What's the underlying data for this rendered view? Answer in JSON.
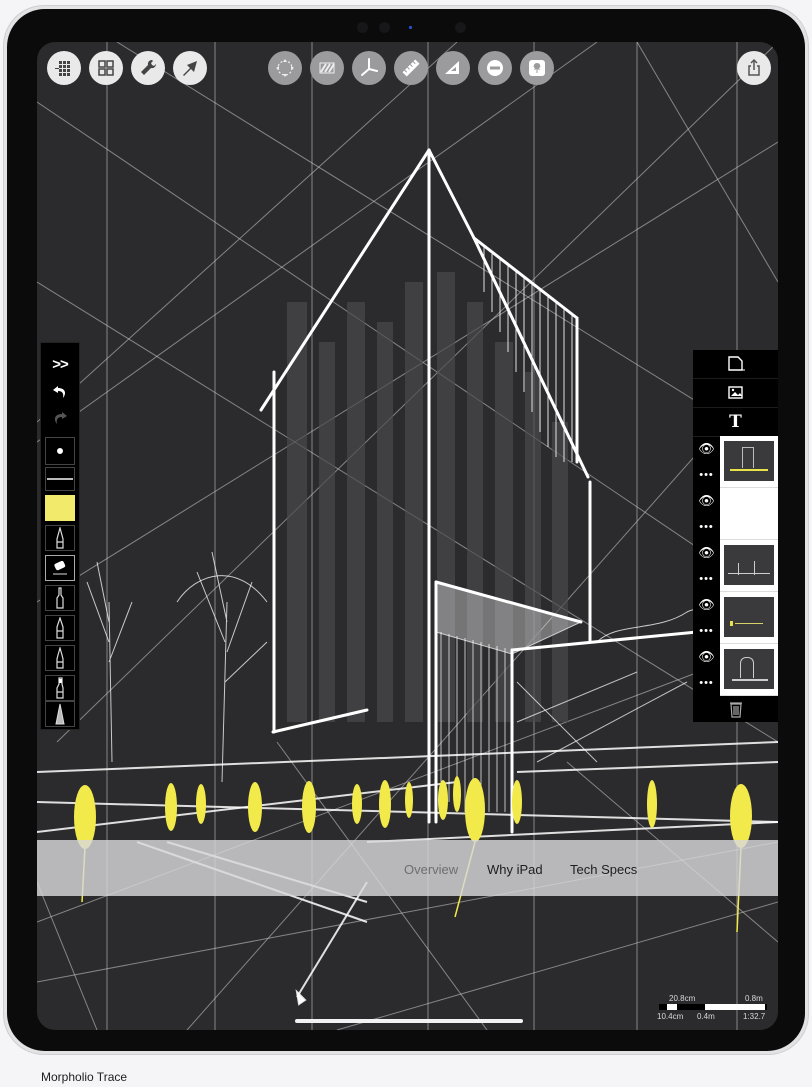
{
  "app": {
    "name": "Morpholio Trace",
    "caption": "Morpholio Trace"
  },
  "top_toolbar": {
    "left_buttons": [
      {
        "icon": "grid-dots-icon",
        "label": "Grid"
      },
      {
        "icon": "gallery-icon",
        "label": "Gallery"
      },
      {
        "icon": "wrench-icon",
        "label": "Settings"
      },
      {
        "icon": "arrow-icon",
        "label": "Select"
      }
    ],
    "center_buttons": [
      {
        "icon": "transform-icon",
        "label": "Transform"
      },
      {
        "icon": "hatch-icon",
        "label": "Hatch"
      },
      {
        "icon": "perspective-icon",
        "label": "Perspective"
      },
      {
        "icon": "ruler-icon",
        "label": "Ruler"
      },
      {
        "icon": "triangle-icon",
        "label": "Triangle"
      },
      {
        "icon": "minus-circle-icon",
        "label": "Ellipse"
      },
      {
        "icon": "tree-stamp-icon",
        "label": "Stamp"
      }
    ],
    "share_button": {
      "icon": "share-icon",
      "label": "Share"
    }
  },
  "left_toolbar": {
    "items": [
      {
        "icon": "collapse-chevrons-icon",
        "label": ">>"
      },
      {
        "icon": "undo-icon",
        "label": "Undo"
      },
      {
        "icon": "redo-icon",
        "label": "Redo"
      },
      {
        "icon": "brush-size-icon",
        "label": "Brush size"
      },
      {
        "icon": "line-weight-icon",
        "label": "Line weight"
      },
      {
        "icon": "color-swatch-icon",
        "label": "Color",
        "color": "#f2ea6a"
      },
      {
        "icon": "pen-icon",
        "label": "Pen"
      },
      {
        "icon": "eraser-icon",
        "label": "Eraser",
        "selected": true
      },
      {
        "icon": "marker-icon",
        "label": "Marker"
      },
      {
        "icon": "pencil-icon",
        "label": "Pencil"
      },
      {
        "icon": "fineliner-icon",
        "label": "Fineliner"
      },
      {
        "icon": "brush-pen-icon",
        "label": "Brush"
      },
      {
        "icon": "chisel-marker-icon",
        "label": "Chisel marker"
      }
    ],
    "double_chevron": ">>"
  },
  "right_panel": {
    "tools": [
      {
        "icon": "new-layer-icon",
        "label": "New layer"
      },
      {
        "icon": "import-image-icon",
        "label": "Import image"
      },
      {
        "icon": "text-icon",
        "label": "T"
      }
    ],
    "layers": [
      {
        "visible": true,
        "thumbnail": "sketch-full",
        "more": "•••"
      },
      {
        "visible": true,
        "thumbnail": "blank",
        "more": "•••"
      },
      {
        "visible": true,
        "thumbnail": "sketch-ground",
        "more": "•••"
      },
      {
        "visible": true,
        "thumbnail": "sketch-people",
        "more": "•••"
      },
      {
        "visible": true,
        "thumbnail": "sketch-building",
        "more": "•••"
      }
    ],
    "text_tool_glyph": "T",
    "delete_icon": "trash-icon"
  },
  "nav": {
    "links": [
      {
        "label": "Overview",
        "active": true
      },
      {
        "label": "Why iPad",
        "active": false
      },
      {
        "label": "Tech Specs",
        "active": false
      }
    ]
  },
  "scale_bar": {
    "top_left": "20.8cm",
    "top_right": "0.8m",
    "bottom_left": "10.4cm",
    "bottom_mid": "0.4m",
    "ratio": "1:32.7"
  },
  "colors": {
    "canvas": "#2b2b2d",
    "sketch_line": "#ffffff",
    "highlight_yellow": "#f2ea4a",
    "toolbar_bg": "#000000"
  }
}
